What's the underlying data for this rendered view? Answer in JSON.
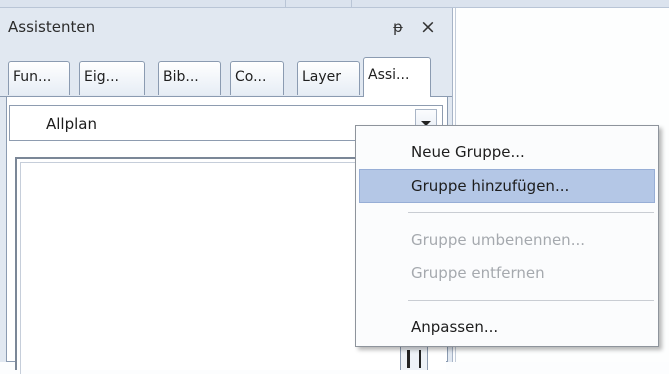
{
  "palette": {
    "title": "Assistenten",
    "pin_glyph": "ᵽ",
    "close_glyph": "×",
    "tabs": [
      {
        "label": "Fun..."
      },
      {
        "label": "Eig..."
      },
      {
        "label": "Bib..."
      },
      {
        "label": "Co..."
      },
      {
        "label": "Layer"
      },
      {
        "label": "Assi..."
      }
    ],
    "combo": {
      "value": "Allplan"
    }
  },
  "context_menu": {
    "items": [
      {
        "label": "Neue Gruppe...",
        "enabled": true
      },
      {
        "label": "Gruppe hinzufügen...",
        "enabled": true,
        "highlighted": true
      },
      {
        "label": "Gruppe umbenennen...",
        "enabled": false
      },
      {
        "label": "Gruppe entfernen",
        "enabled": false
      },
      {
        "label": "Anpassen...",
        "enabled": true
      }
    ]
  },
  "colors": {
    "panel_bg": "#e1e8f1",
    "menu_highlight": "#b4c7e6",
    "disabled_text": "#a5a9ae"
  }
}
